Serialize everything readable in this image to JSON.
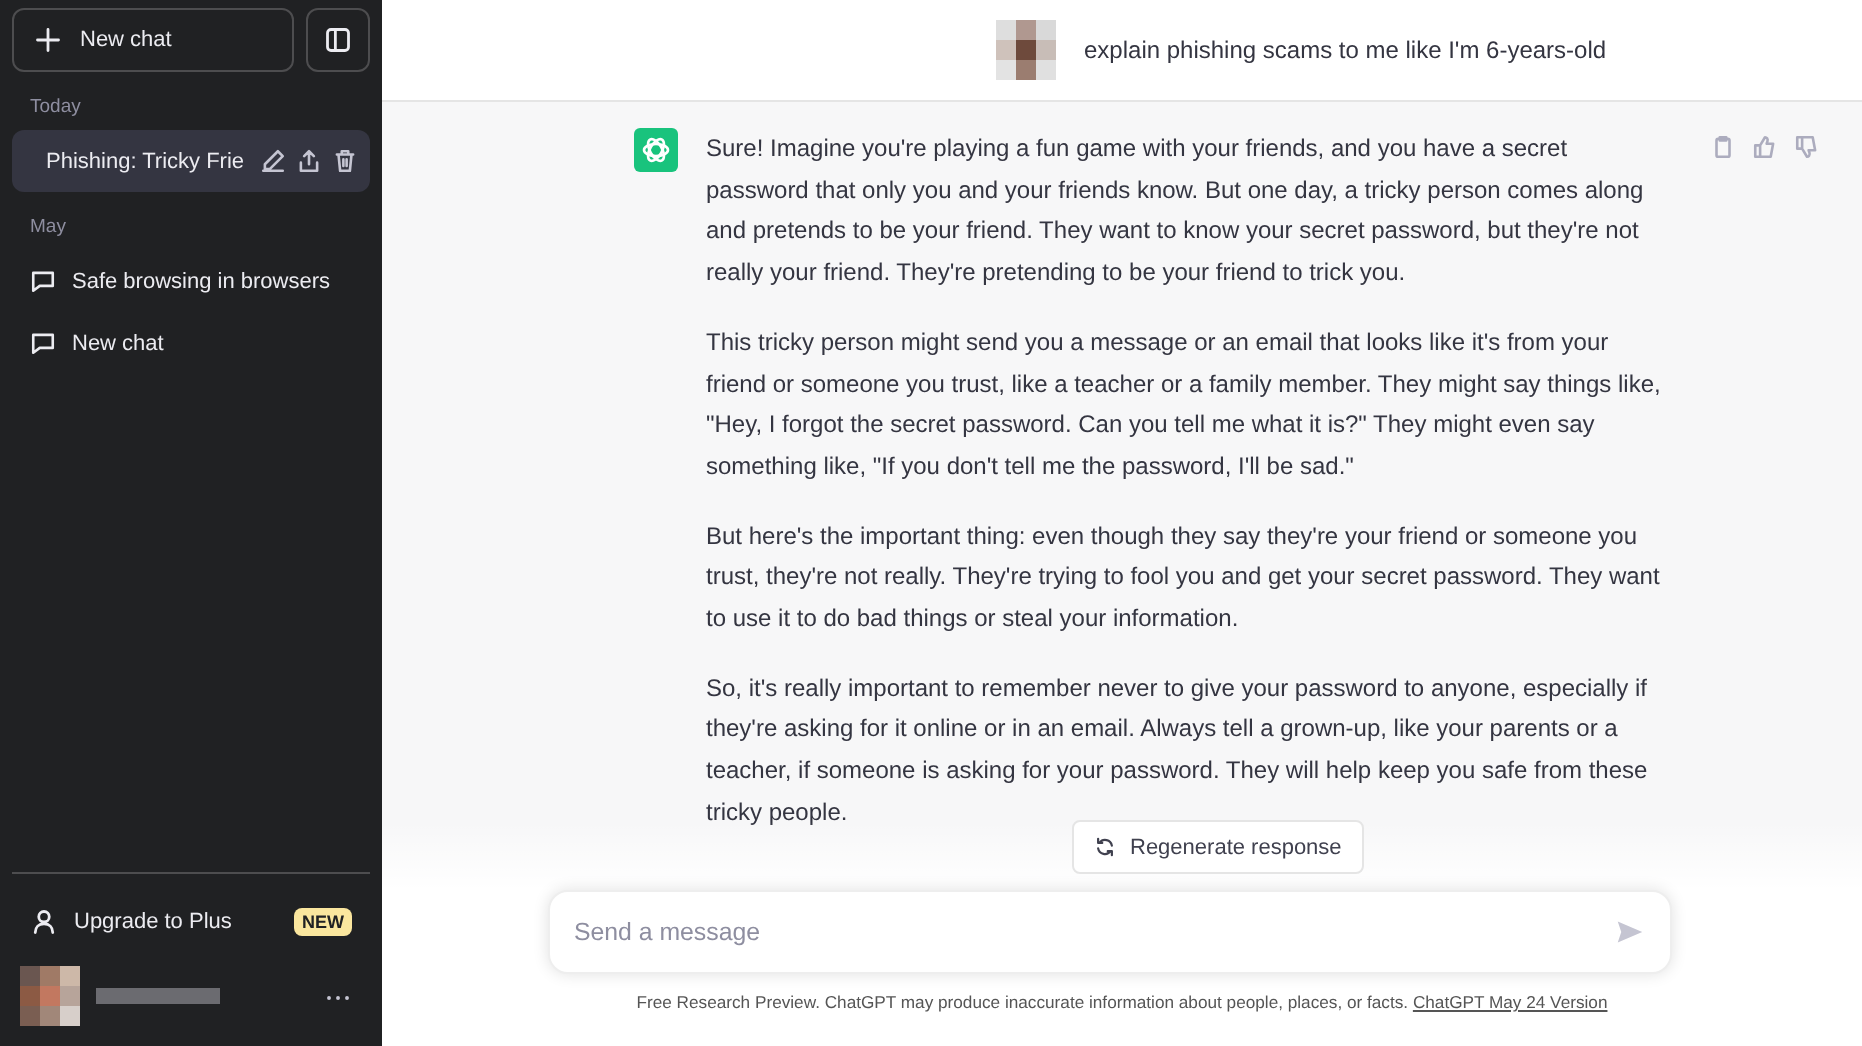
{
  "sidebar": {
    "new_chat_button": "New chat",
    "groups": [
      {
        "label": "Today",
        "items": [
          {
            "title": "Phishing: Tricky Frie",
            "selected": true
          }
        ]
      },
      {
        "label": "May",
        "items": [
          {
            "title": "Safe browsing in browsers",
            "selected": false
          },
          {
            "title": "New chat",
            "selected": false
          }
        ]
      }
    ],
    "upgrade": {
      "label": "Upgrade to Plus",
      "badge": "NEW"
    }
  },
  "conversation": [
    {
      "kind": "user",
      "paragraphs": [
        "explain phishing scams to me like I'm 6-years-old"
      ]
    },
    {
      "kind": "assistant",
      "paragraphs": [
        "Sure! Imagine you're playing a fun game with your friends, and you have a secret password that only you and your friends know. But one day, a tricky person comes along and pretends to be your friend. They want to know your secret password, but they're not really your friend. They're pretending to be your friend to trick you.",
        "This tricky person might send you a message or an email that looks like it's from your friend or someone you trust, like a teacher or a family member. They might say things like, \"Hey, I forgot the secret password. Can you tell me what it is?\" They might even say something like, \"If you don't tell me the password, I'll be sad.\"",
        "But here's the important thing: even though they say they're your friend or someone you trust, they're not really. They're trying to fool you and get your secret password. They want to use it to do bad things or steal your information.",
        "So, it's really important to remember never to give your password to anyone, especially if they're asking for it online or in an email. Always tell a grown-up, like your parents or a teacher, if someone is asking for your password. They will help keep you safe from these tricky people."
      ]
    }
  ],
  "regenerate_button": "Regenerate response",
  "composer": {
    "placeholder": "Send a message"
  },
  "footer": {
    "text": "Free Research Preview. ChatGPT may produce inaccurate information about people, places, or facts.",
    "link": "ChatGPT May 24 Version"
  }
}
